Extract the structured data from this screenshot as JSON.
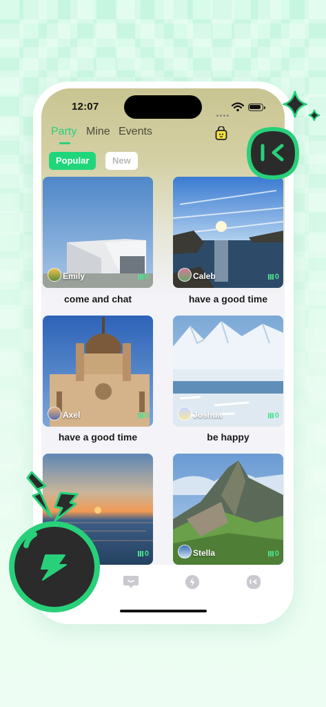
{
  "status_bar": {
    "time": "12:07"
  },
  "tabs": [
    {
      "label": "Party",
      "active": true
    },
    {
      "label": "Mine",
      "active": false
    },
    {
      "label": "Events",
      "active": false
    }
  ],
  "filters": [
    {
      "label": "Popular",
      "active": true
    },
    {
      "label": "New",
      "active": false
    }
  ],
  "rooms": [
    {
      "host": "Emily",
      "title": "come and chat",
      "listeners": "0"
    },
    {
      "host": "Caleb",
      "title": "have a good time",
      "listeners": "0"
    },
    {
      "host": "Axel",
      "title": "have a good time",
      "listeners": "0"
    },
    {
      "host": "Joshua",
      "title": "be happy",
      "listeners": "0"
    },
    {
      "host": "",
      "title": "",
      "listeners": "0"
    },
    {
      "host": "Stella",
      "title": "",
      "listeners": "0"
    }
  ],
  "colors": {
    "accent": "#1fd67b",
    "dark": "#2b2b2b",
    "neon": "#28d07a"
  },
  "icons": {
    "header": "shopping-bag-icon",
    "nav": [
      "chat-bubble-icon",
      "lightning-icon",
      "party-face-icon"
    ]
  }
}
